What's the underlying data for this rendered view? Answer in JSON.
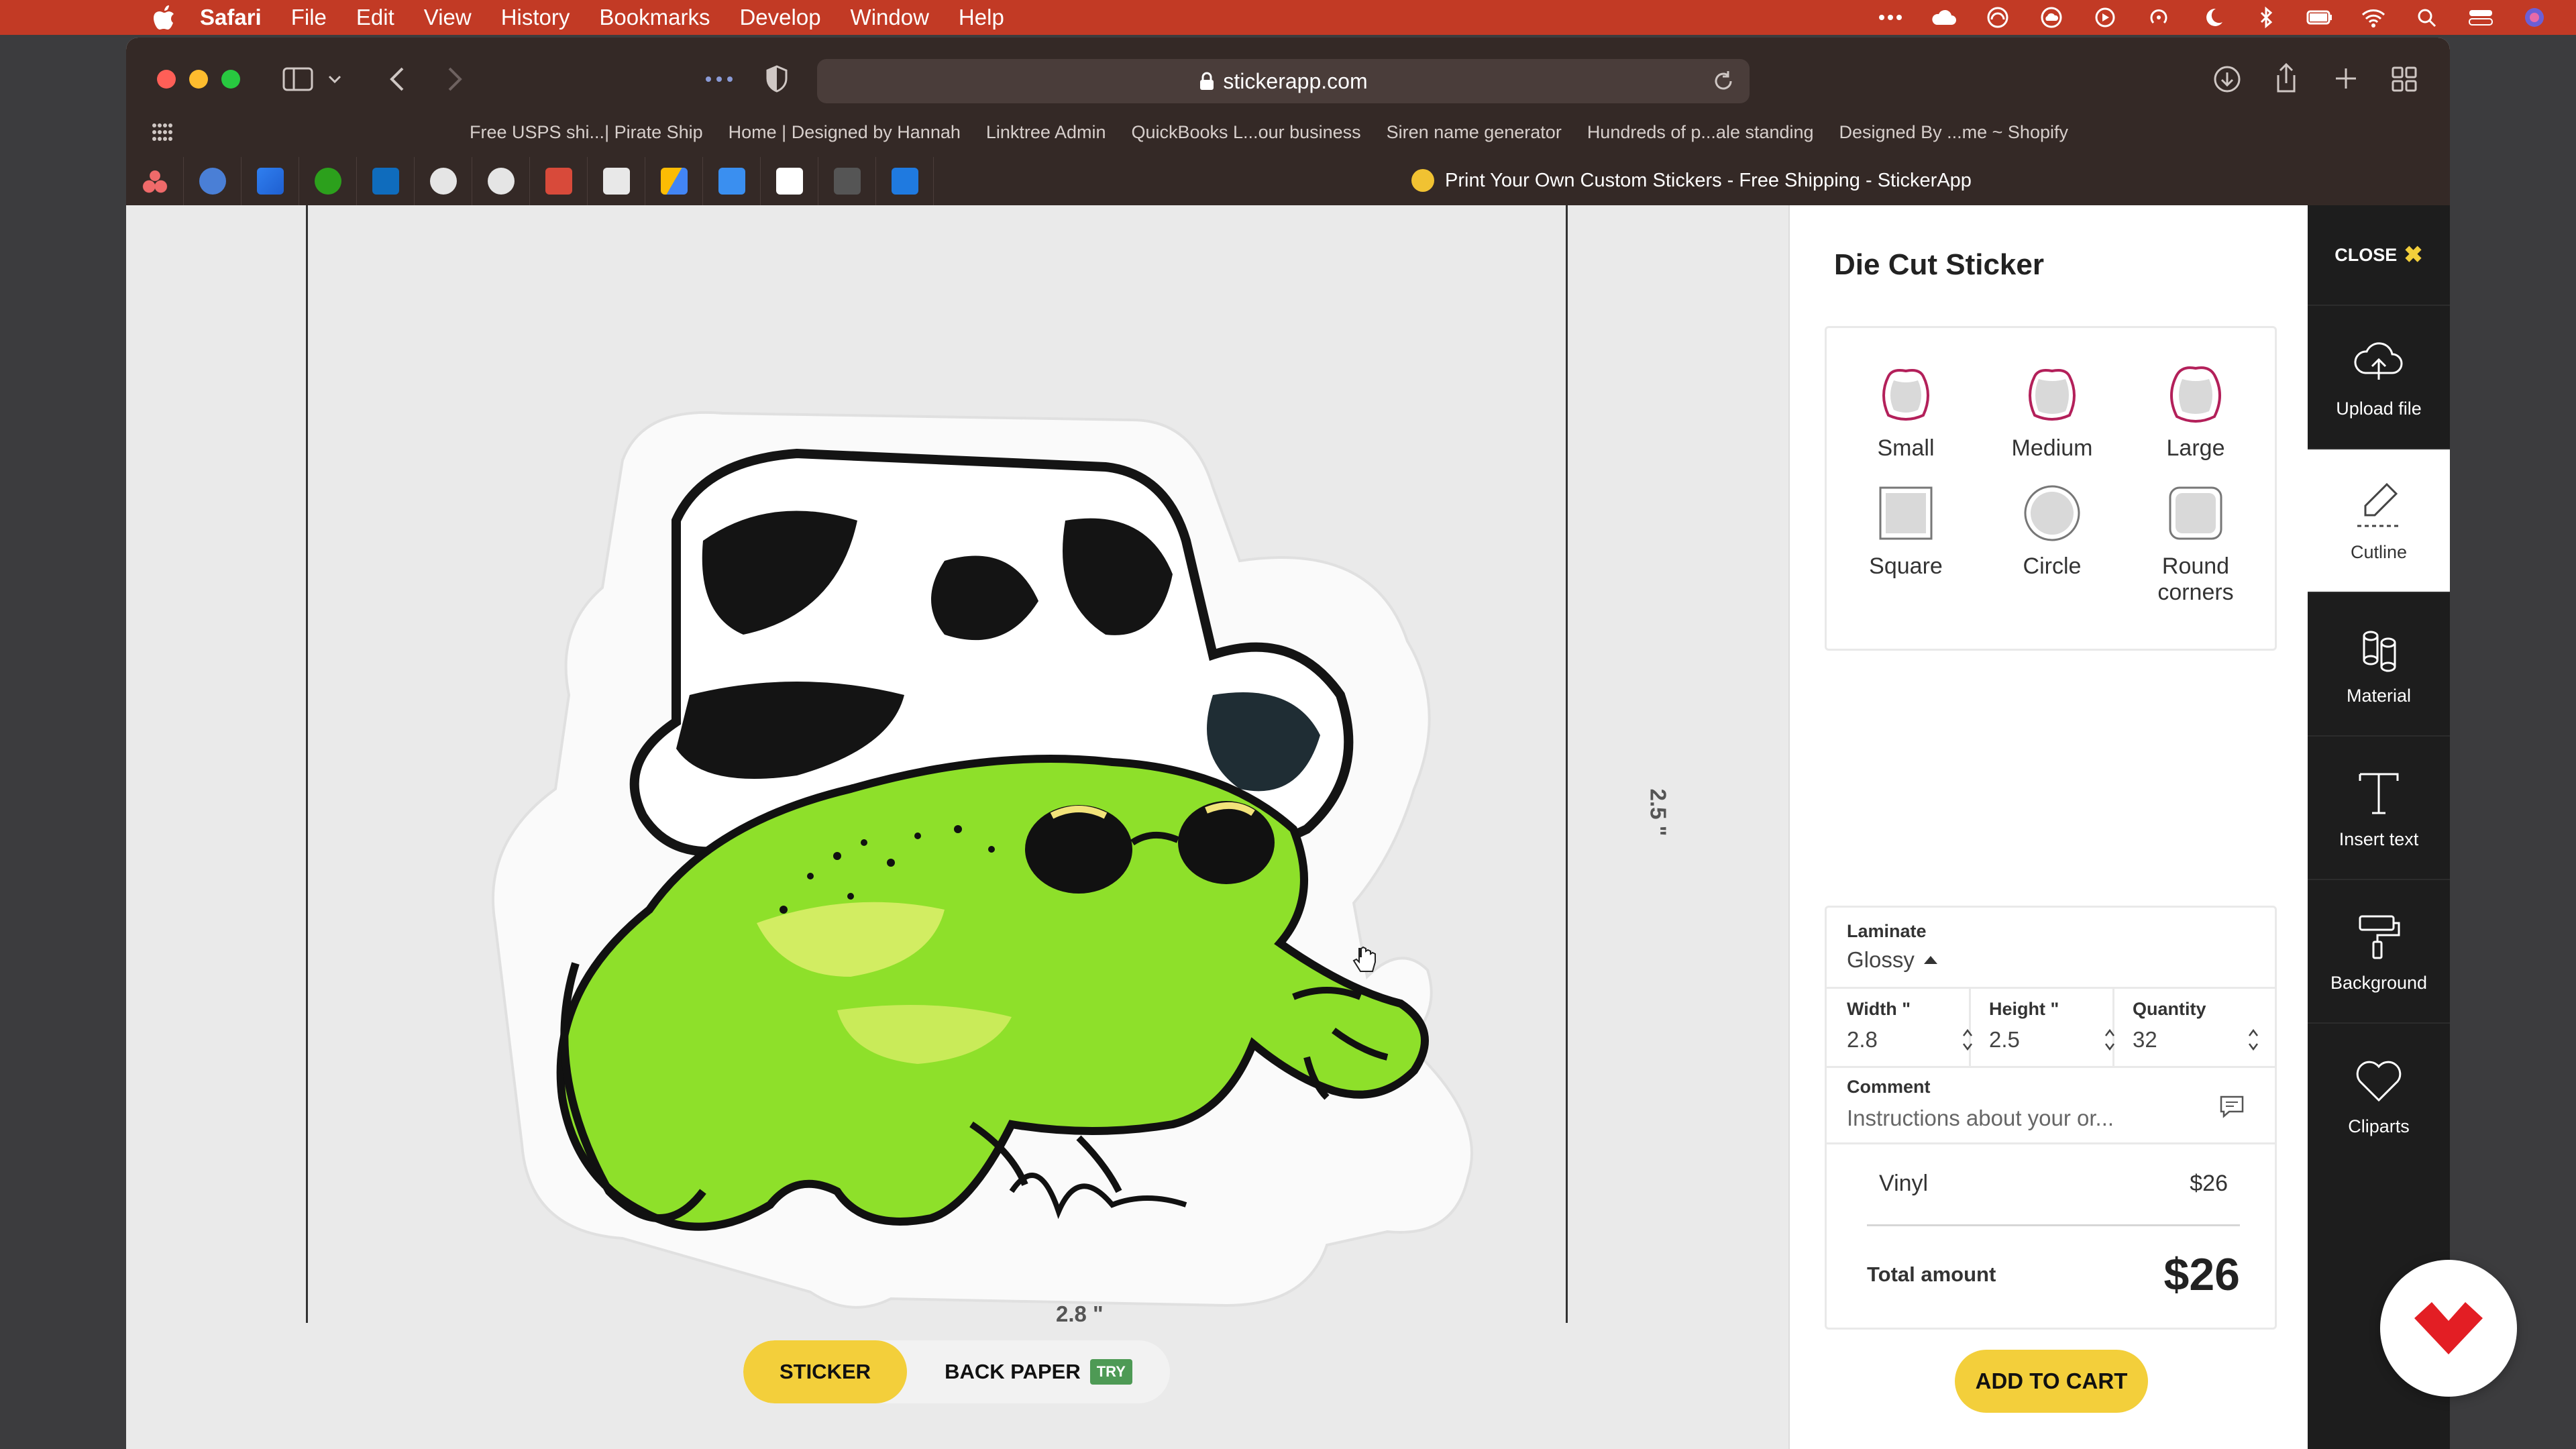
{
  "menubar": {
    "app": "Safari",
    "items": [
      "File",
      "Edit",
      "View",
      "History",
      "Bookmarks",
      "Develop",
      "Window",
      "Help"
    ]
  },
  "browser": {
    "url": "stickerapp.com",
    "bookmarks": [
      "Free USPS shi...| Pirate Ship",
      "Home | Designed by Hannah",
      "Linktree Admin",
      "QuickBooks L...our business",
      "Siren name generator",
      "Hundreds of p...ale standing",
      "Designed By ...me ~ Shopify"
    ],
    "tab_title": "Print Your Own Custom Stickers - Free Shipping - StickerApp"
  },
  "canvas": {
    "width_label": "2.8 \"",
    "height_label": "2.5 \"",
    "mode_sticker": "STICKER",
    "mode_backpaper": "BACK PAPER",
    "try_badge": "TRY"
  },
  "panel": {
    "title": "Die Cut Sticker",
    "shapes": [
      {
        "label": "Small",
        "selected": true
      },
      {
        "label": "Medium",
        "selected": true
      },
      {
        "label": "Large",
        "selected": true
      },
      {
        "label": "Square",
        "selected": false
      },
      {
        "label": "Circle",
        "selected": false
      },
      {
        "label": "Round corners",
        "selected": false
      }
    ],
    "laminate_label": "Laminate",
    "laminate_value": "Glossy",
    "width_label": "Width \"",
    "width_value": "2.8",
    "height_label": "Height \"",
    "height_value": "2.5",
    "quantity_label": "Quantity",
    "quantity_value": "32",
    "comment_label": "Comment",
    "comment_placeholder": "Instructions about your or...",
    "line_item_name": "Vinyl",
    "line_item_price": "$26",
    "total_label": "Total amount",
    "total_value": "$26",
    "add_to_cart": "ADD TO CART"
  },
  "tools": {
    "close_label": "CLOSE",
    "items": [
      {
        "label": "Upload file",
        "icon": "cloud-upload-icon"
      },
      {
        "label": "Cutline",
        "icon": "cutline-pen-icon"
      },
      {
        "label": "Material",
        "icon": "material-rolls-icon"
      },
      {
        "label": "Insert text",
        "icon": "text-t-icon"
      },
      {
        "label": "Background",
        "icon": "paint-roller-icon"
      },
      {
        "label": "Cliparts",
        "icon": "heart-icon"
      }
    ]
  },
  "colors": {
    "menubar": "#c23a25",
    "chrome": "#342926",
    "accent_yellow": "#f3cf3b",
    "tools_bg": "#1d1d1d",
    "brand_red": "#e31e24",
    "frog_green": "#8ee02a"
  }
}
